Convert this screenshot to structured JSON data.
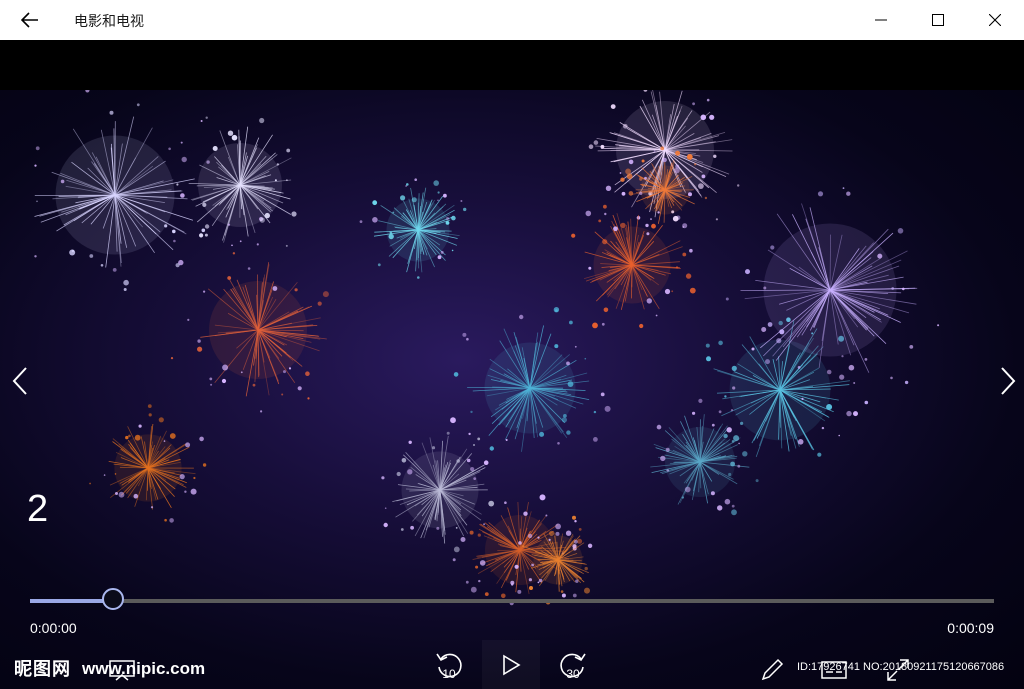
{
  "app": {
    "title": "电影和电视"
  },
  "player": {
    "slide_number": "2",
    "time_elapsed": "0:00:00",
    "time_total": "0:00:09",
    "progress_fraction": 0.086,
    "skip_back_label": "10",
    "skip_forward_label": "30"
  },
  "watermark": {
    "logo": "昵图网",
    "site": "www.nipic.com",
    "id_text": "ID:17926741 NO:20180921175120667086"
  },
  "icons": {
    "back": "back-arrow-icon",
    "minimize": "minimize-icon",
    "maximize": "maximize-icon",
    "close": "close-icon",
    "prev": "chevron-left-icon",
    "next": "chevron-right-icon",
    "play": "play-icon",
    "skip_back": "skip-back-10-icon",
    "skip_forward": "skip-forward-30-icon",
    "cast": "cast-icon",
    "edit": "pen-icon",
    "subtitles": "subtitles-icon",
    "fullscreen": "fullscreen-icon"
  },
  "colors": {
    "titlebar_bg": "#ffffff",
    "seek_fill": "#9aa8e6",
    "seek_track": "#5b5b5b",
    "video_bg": "#170e3a"
  }
}
